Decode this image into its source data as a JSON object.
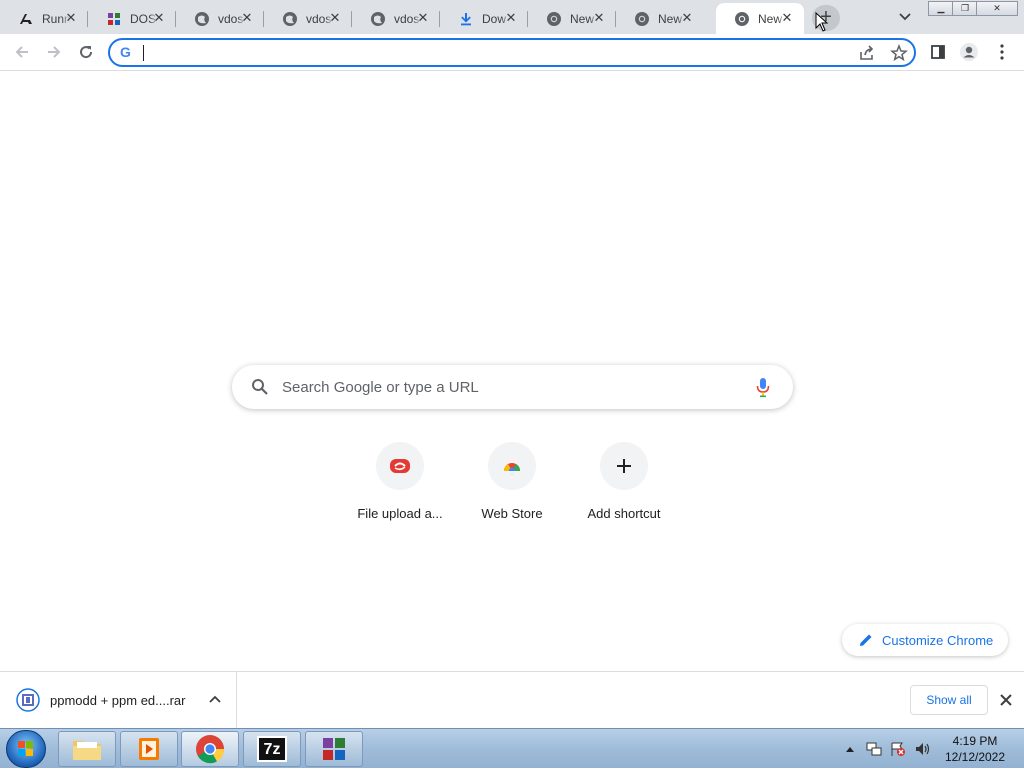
{
  "browser": {
    "tabs": [
      {
        "title": "Runn",
        "icon": "runner-icon",
        "active": false
      },
      {
        "title": "DOS",
        "icon": "dosbox-icon",
        "active": false
      },
      {
        "title": "vdos",
        "icon": "globe-icon",
        "active": false
      },
      {
        "title": "vdos",
        "icon": "globe-icon",
        "active": false
      },
      {
        "title": "vdos",
        "icon": "globe-icon",
        "active": false
      },
      {
        "title": "Dow",
        "icon": "download-icon",
        "active": false
      },
      {
        "title": "New",
        "icon": "chrome-icon",
        "active": false
      },
      {
        "title": "New",
        "icon": "chrome-icon",
        "active": false
      },
      {
        "title": "New",
        "icon": "chrome-icon",
        "active": true
      }
    ],
    "close_glyph": "✕",
    "new_tab_glyph": "+",
    "omnibox_value": "",
    "omnibox_g": "G"
  },
  "ntp": {
    "search_placeholder": "Search Google or type a URL",
    "shortcuts": [
      {
        "label": "File upload a...",
        "icon": "file-upload-icon"
      },
      {
        "label": "Web Store",
        "icon": "web-store-icon"
      },
      {
        "label": "Add shortcut",
        "icon": "plus-icon"
      }
    ],
    "customize_label": "Customize Chrome"
  },
  "downloads": {
    "file_name": "ppmodd + ppm ed....rar",
    "show_all_label": "Show all"
  },
  "taskbar": {
    "time": "4:19 PM",
    "date": "12/12/2022",
    "sevenzip_label": "7z"
  },
  "colors": {
    "accent": "#1a73e8",
    "tabstrip": "#dee1e6"
  }
}
